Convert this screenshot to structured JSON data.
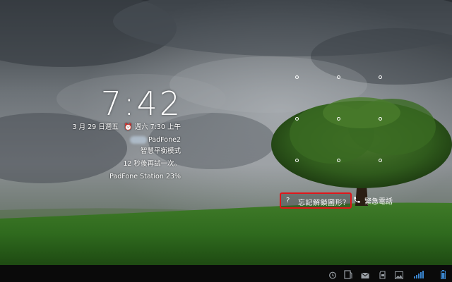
{
  "lockscreen": {
    "time": "7:42",
    "date": "3 月 29 日週五",
    "alarm_icon": "alarm-clock-icon",
    "alarm": "週六 7:30 上午",
    "owner": "PadFone2",
    "mode": "智慧平衡模式",
    "retry_message": "12 秒後再試一次。",
    "station_battery": "PadFone Station 23%"
  },
  "actions": {
    "forgot_pattern_icon": "?",
    "forgot_pattern": "忘記解鎖圖形？",
    "emergency_call": "緊急電話"
  },
  "status_bar": {
    "icons": [
      "alarm-icon",
      "document-icon",
      "email-icon",
      "sd-card-icon",
      "picture-icon",
      "signal-icon",
      "battery-icon"
    ]
  }
}
